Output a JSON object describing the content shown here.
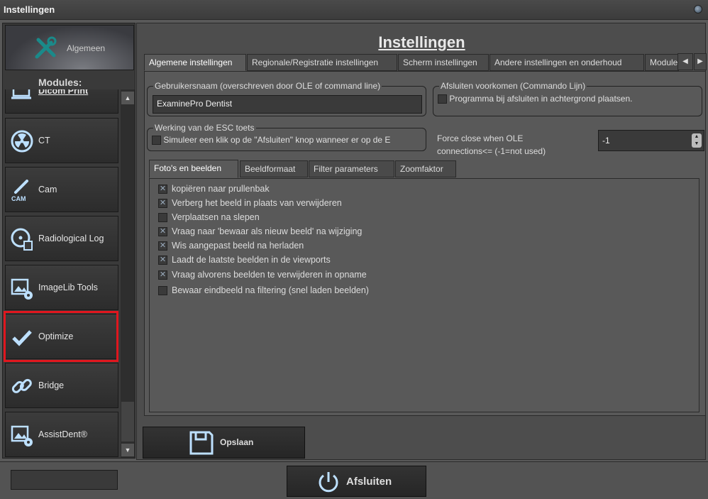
{
  "window": {
    "title": "Instellingen"
  },
  "sidebar": {
    "general_label": "Algemeen",
    "modules_label": "Modules:",
    "modules": [
      {
        "label": "Dicom Print",
        "icon": "laptop-icon"
      },
      {
        "label": "CT",
        "icon": "radiation-icon"
      },
      {
        "label": "Cam",
        "icon": "intraoral-camera-icon"
      },
      {
        "label": "Radiological Log",
        "icon": "radiation-log-icon"
      },
      {
        "label": "ImageLib Tools",
        "icon": "image-gear-icon"
      },
      {
        "label": "Optimize",
        "icon": "checkmark-icon",
        "highlighted": true
      },
      {
        "label": "Bridge",
        "icon": "link-icon"
      },
      {
        "label": "AssistDent®",
        "icon": "image-gear-icon"
      }
    ]
  },
  "main": {
    "title": "Instellingen",
    "tabs": [
      "Algemene instellingen",
      "Regionale/Registratie instellingen",
      "Scherm instellingen",
      "Andere instellingen en onderhoud",
      "Module"
    ],
    "selected_tab": 0,
    "username_group": {
      "legend": "Gebruikersnaam (overschreven door OLE of command line)",
      "value": "ExaminePro Dentist"
    },
    "prevent_close_group": {
      "legend": "Afsluiten voorkomen (Commando Lijn)",
      "checkbox_label": "Programma bij afsluiten in achtergrond plaatsen.",
      "checked": false
    },
    "esc_group": {
      "legend": "Werking van de ESC toets",
      "checkbox_label": "Simuleer een klik op de \"Afsluiten\" knop wanneer er op de E",
      "checked": false
    },
    "force_close": {
      "label_line1": "Force close  when OLE",
      "label_line2": "connections<= (-1=not used)",
      "value": "-1"
    },
    "subtabs": [
      "Foto's en beelden",
      "Beeldformaat",
      "Filter parameters",
      "Zoomfaktor"
    ],
    "options": [
      {
        "label": "kopiëren naar prullenbak",
        "checked": true
      },
      {
        "label": "Verberg het beeld in plaats van verwijderen",
        "checked": true
      },
      {
        "label": "Verplaatsen na slepen",
        "checked": false
      },
      {
        "label": "Vraag naar 'bewaar als nieuw beeld' na wijziging",
        "checked": true
      },
      {
        "label": "Wis aangepast beeld na herladen",
        "checked": true
      },
      {
        "label": "Laadt de laatste beelden in de viewports",
        "checked": true
      },
      {
        "label": "Vraag alvorens beelden te verwijderen in opname",
        "checked": true
      },
      {
        "label": "Bewaar eindbeeld na filtering (snel laden beelden)",
        "checked": false
      }
    ],
    "save_label": "Opslaan"
  },
  "footer": {
    "input_value": "",
    "exit_label": "Afsluiten"
  },
  "colors": {
    "accent_icon": "#bde0ff",
    "highlight": "#e0161e",
    "general_icon": "#1a8a8a"
  }
}
